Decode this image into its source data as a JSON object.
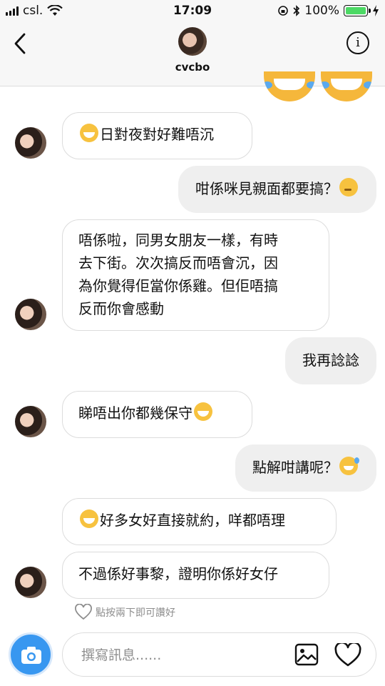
{
  "status": {
    "carrier": "csl.",
    "time": "17:09",
    "battery": "100%",
    "battery_level": 1.0
  },
  "header": {
    "username": "cvcbo"
  },
  "messages": [
    {
      "side": "in",
      "emoji_before": "laugh-cry",
      "text": "日對夜對好難唔沉"
    },
    {
      "side": "out",
      "text": "咁係咪見親面都要搞？",
      "emoji_after": "thinking"
    },
    {
      "side": "in",
      "lines": [
        "唔係啦，同男女朋友一樣，有時",
        "去下街。次次搞反而唔會沉，因",
        "為你覺得佢當你係雞。但佢唔搞",
        "反而你會感動"
      ]
    },
    {
      "side": "out",
      "text": "我再諗諗"
    },
    {
      "side": "in",
      "text": "睇唔出你都幾保守",
      "emoji_after": "laugh-cry"
    },
    {
      "side": "out",
      "text": "點解咁講呢？",
      "emoji_after": "sweat-smile"
    },
    {
      "side": "in",
      "emoji_before": "laugh-cry",
      "text": "好多女好直接就約，咩都唔理"
    },
    {
      "side": "in",
      "text": "不過係好事黎，證明你係好女仔"
    }
  ],
  "like_hint": "點按兩下即可讚好",
  "composer": {
    "placeholder": "撰寫訊息......",
    "value": ""
  },
  "icons": {
    "back": "chevron-left-icon",
    "info": "info-icon",
    "camera": "camera-icon",
    "gallery": "gallery-icon",
    "heart": "heart-icon",
    "wifi": "wifi-icon",
    "bluetooth": "bluetooth-icon",
    "charging": "charging-icon"
  },
  "colors": {
    "camera_button": "#3897f0",
    "battery_fill": "#4cd964",
    "outgoing_bubble": "#efefef"
  }
}
